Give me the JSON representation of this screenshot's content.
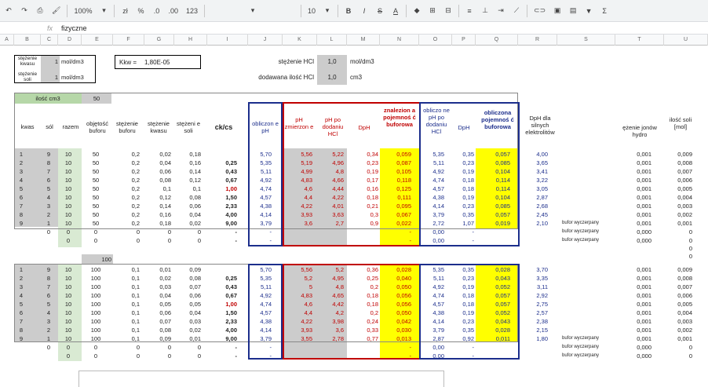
{
  "toolbar": {
    "zoom": "100%",
    "currency": "zł",
    "percent": "%",
    "dec_minus": ".0",
    "dec_plus": ".00",
    "format": "123",
    "font_size": "10",
    "bold": "B",
    "italic": "I",
    "strike": "S",
    "text_color": "A"
  },
  "formula_bar": {
    "fx": "fx",
    "content": "fizyczne"
  },
  "columns": [
    "A",
    "B",
    "C",
    "D",
    "E",
    "F",
    "G",
    "H",
    "I",
    "J",
    "K",
    "L",
    "M",
    "N",
    "O",
    "P",
    "Q",
    "R",
    "S",
    "T",
    "U"
  ],
  "top": {
    "stezenie_kwasu_label": "stężenie kwasu",
    "kwas_val": "1",
    "kwas_unit": "mol/dm3",
    "stezenie_soli_label": "stężenie soli",
    "sol_val": "1",
    "sol_unit": "mol/dm3",
    "kkw_label": "Kkw =",
    "kkw_val": "1,80E-05",
    "hcl_label": "stężenie HCl",
    "hcl_val": "1,0",
    "hcl_unit": "mol/dm3",
    "dod_label": "dodawana ilość HCl",
    "dod_val": "1,0",
    "dod_unit": "cm3"
  },
  "headers": {
    "ilosc": "ilość cm3",
    "ilosc_val": "50",
    "kwas": "kwas",
    "sol": "sól",
    "razem": "razem",
    "objetosc": "objętość buforu",
    "st_buforu": "stężenie buforu",
    "st_kwasu": "stężenie kwasu",
    "st_soli": "stężeni e soli",
    "ckcs": "ck/cs",
    "obliczone": "obliczon e pH",
    "ph_zmier": "pH zmierzon e",
    "ph_po": "pH po dodaniu HCl",
    "dph": "DpH",
    "znaleziona": "znalezion a pojemnoś ć buforowa",
    "obl_ph_po": "obliczo ne pH po dodaniu HCl",
    "dph2": "DpH",
    "obl_poj": "obliczona pojemnoś ć buforowa",
    "dph_slabych": "DpH dla silnych elektrolitów",
    "st_jonow": "ężenie jonów hydro",
    "ilosc_soli": "ilość soli [mol]",
    "ilosc2_val": "100"
  },
  "table1": [
    [
      "1",
      "9",
      "10",
      "50",
      "0,2",
      "0,02",
      "0,18",
      "0,11",
      "5,70",
      "5,56",
      "5,22",
      "0,34",
      "0,059",
      "5,35",
      "0,35",
      "0,057",
      "4,00",
      "",
      "0,001",
      "0,009"
    ],
    [
      "2",
      "8",
      "10",
      "50",
      "0,2",
      "0,04",
      "0,16",
      "0,25",
      "5,35",
      "5,19",
      "4,96",
      "0,23",
      "0,087",
      "5,11",
      "0,23",
      "0,085",
      "3,65",
      "",
      "0,001",
      "0,008"
    ],
    [
      "3",
      "7",
      "10",
      "50",
      "0,2",
      "0,06",
      "0,14",
      "0,43",
      "5,11",
      "4,99",
      "4,8",
      "0,19",
      "0,105",
      "4,92",
      "0,19",
      "0,104",
      "3,41",
      "",
      "0,001",
      "0,007"
    ],
    [
      "4",
      "6",
      "10",
      "50",
      "0,2",
      "0,08",
      "0,12",
      "0,67",
      "4,92",
      "4,83",
      "4,66",
      "0,17",
      "0,118",
      "4,74",
      "0,18",
      "0,114",
      "3,22",
      "",
      "0,001",
      "0,006"
    ],
    [
      "5",
      "5",
      "10",
      "50",
      "0,2",
      "0,1",
      "0,1",
      "1,00",
      "4,74",
      "4,6",
      "4,44",
      "0,16",
      "0,125",
      "4,57",
      "0,18",
      "0,114",
      "3,05",
      "",
      "0,001",
      "0,005"
    ],
    [
      "6",
      "4",
      "10",
      "50",
      "0,2",
      "0,12",
      "0,08",
      "1,50",
      "4,57",
      "4,4",
      "4,22",
      "0,18",
      "0,111",
      "4,38",
      "0,19",
      "0,104",
      "2,87",
      "",
      "0,001",
      "0,004"
    ],
    [
      "7",
      "3",
      "10",
      "50",
      "0,2",
      "0,14",
      "0,06",
      "2,33",
      "4,38",
      "4,22",
      "4,01",
      "0,21",
      "0,095",
      "4,14",
      "0,23",
      "0,085",
      "2,68",
      "",
      "0,001",
      "0,003"
    ],
    [
      "8",
      "2",
      "10",
      "50",
      "0,2",
      "0,16",
      "0,04",
      "4,00",
      "4,14",
      "3,93",
      "3,63",
      "0,3",
      "0,067",
      "3,79",
      "0,35",
      "0,057",
      "2,45",
      "",
      "0,001",
      "0,002"
    ],
    [
      "9",
      "1",
      "10",
      "50",
      "0,2",
      "0,18",
      "0,02",
      "9,00",
      "3,79",
      "3,6",
      "2,7",
      "0,9",
      "0,022",
      "2,72",
      "1,07",
      "0,019",
      "2,10",
      "bufor wyczerpany",
      "0,001",
      "0,001"
    ],
    [
      "",
      "0",
      "0",
      "0",
      "0",
      "0",
      "0",
      "-",
      "-",
      "",
      "",
      "",
      "-",
      "0,00",
      "-",
      "",
      "",
      "bufor wyczerpany",
      "0,000",
      "0"
    ],
    [
      "",
      "",
      "0",
      "0",
      "0",
      "0",
      "0",
      "-",
      "-",
      "",
      "",
      "",
      "-",
      "0,00",
      "-",
      "",
      "",
      "bufor wyczerpany",
      "0,000",
      "0"
    ]
  ],
  "table2": [
    [
      "1",
      "9",
      "10",
      "100",
      "0,1",
      "0,01",
      "0,09",
      "0,11",
      "5,70",
      "5,56",
      "5,2",
      "0,36",
      "0,028",
      "5,35",
      "0,35",
      "0,028",
      "3,70",
      "",
      "0,001",
      "0,009"
    ],
    [
      "2",
      "8",
      "10",
      "100",
      "0,1",
      "0,02",
      "0,08",
      "0,25",
      "5,35",
      "5,2",
      "4,95",
      "0,25",
      "0,040",
      "5,11",
      "0,23",
      "0,043",
      "3,35",
      "",
      "0,001",
      "0,008"
    ],
    [
      "3",
      "7",
      "10",
      "100",
      "0,1",
      "0,03",
      "0,07",
      "0,43",
      "5,11",
      "5",
      "4,8",
      "0,2",
      "0,050",
      "4,92",
      "0,19",
      "0,052",
      "3,11",
      "",
      "0,001",
      "0,007"
    ],
    [
      "4",
      "6",
      "10",
      "100",
      "0,1",
      "0,04",
      "0,06",
      "0,67",
      "4,92",
      "4,83",
      "4,65",
      "0,18",
      "0,056",
      "4,74",
      "0,18",
      "0,057",
      "2,92",
      "",
      "0,001",
      "0,006"
    ],
    [
      "5",
      "5",
      "10",
      "100",
      "0,1",
      "0,05",
      "0,05",
      "1,00",
      "4,74",
      "4,6",
      "4,42",
      "0,18",
      "0,056",
      "4,57",
      "0,18",
      "0,057",
      "2,75",
      "",
      "0,001",
      "0,005"
    ],
    [
      "6",
      "4",
      "10",
      "100",
      "0,1",
      "0,06",
      "0,04",
      "1,50",
      "4,57",
      "4,4",
      "4,2",
      "0,2",
      "0,050",
      "4,38",
      "0,19",
      "0,052",
      "2,57",
      "",
      "0,001",
      "0,004"
    ],
    [
      "7",
      "3",
      "10",
      "100",
      "0,1",
      "0,07",
      "0,03",
      "2,33",
      "4,38",
      "4,22",
      "3,98",
      "0,24",
      "0,042",
      "4,14",
      "0,23",
      "0,043",
      "2,38",
      "",
      "0,001",
      "0,003"
    ],
    [
      "8",
      "2",
      "10",
      "100",
      "0,1",
      "0,08",
      "0,02",
      "4,00",
      "4,14",
      "3,93",
      "3,6",
      "0,33",
      "0,030",
      "3,79",
      "0,35",
      "0,028",
      "2,15",
      "",
      "0,001",
      "0,002"
    ],
    [
      "9",
      "1",
      "10",
      "100",
      "0,1",
      "0,09",
      "0,01",
      "9,00",
      "3,79",
      "3,55",
      "2,78",
      "0,77",
      "0,013",
      "2,87",
      "0,92",
      "0,011",
      "1,80",
      "bufor wyczerpany",
      "0,001",
      "0,001"
    ],
    [
      "",
      "0",
      "0",
      "0",
      "0",
      "0",
      "0",
      "-",
      "-",
      "",
      "",
      "",
      "-",
      "0,00",
      "-",
      "",
      "",
      "bufor wyczerpany",
      "0,000",
      "0"
    ],
    [
      "",
      "",
      "0",
      "0",
      "0",
      "0",
      "0",
      "-",
      "-",
      "",
      "",
      "",
      "-",
      "0,00",
      "-",
      "",
      "",
      "bufor wyczerpany",
      "0,000",
      "0"
    ]
  ],
  "extra_zeros": [
    "0",
    "0"
  ]
}
